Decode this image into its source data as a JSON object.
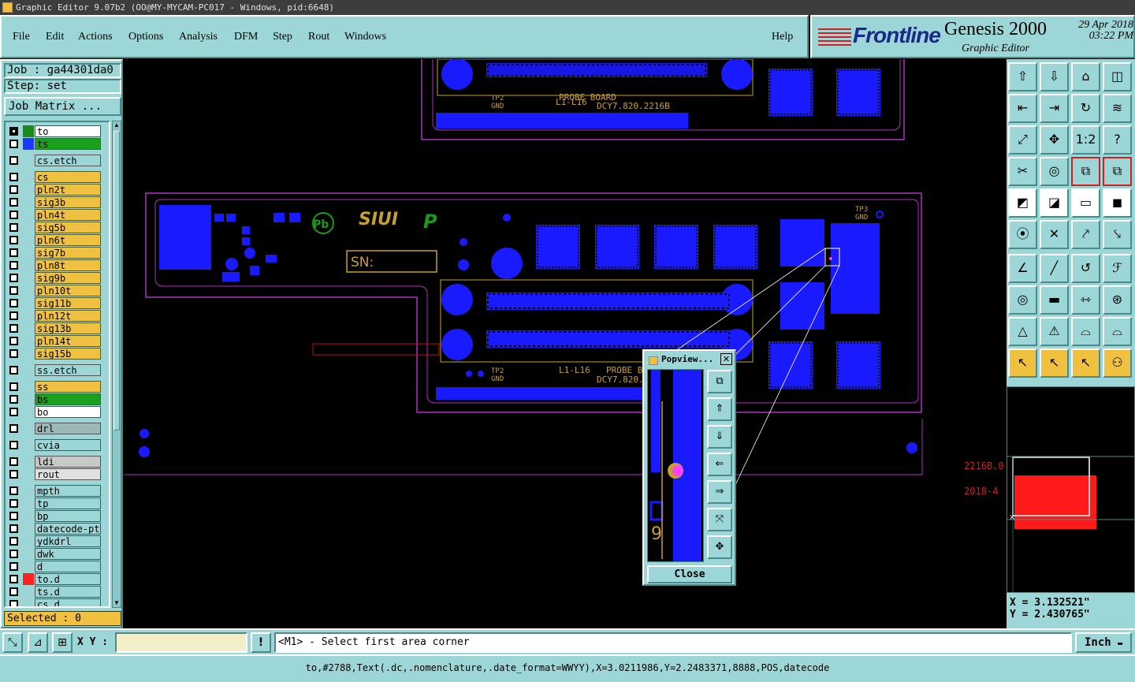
{
  "window": {
    "title": "Graphic Editor 9.07b2 (OO@MY-MYCAM-PC017 - Windows, pid:6648)"
  },
  "menu": {
    "file": "File",
    "edit": "Edit",
    "actions": "Actions",
    "options": "Options",
    "analysis": "Analysis",
    "dfm": "DFM",
    "step": "Step",
    "rout": "Rout",
    "windows": "Windows",
    "help": "Help"
  },
  "brand": {
    "logo": "Frontline",
    "product": "Genesis 2000",
    "subtitle": "Graphic Editor",
    "date": "29 Apr 2018",
    "time": "03:22 PM"
  },
  "job": {
    "job_label": "Job : ga44301da0",
    "step_label": "Step: set",
    "job_matrix": "Job Matrix ..."
  },
  "layers": [
    {
      "name": "to",
      "swatch": "#1a8a1a",
      "bg": "#ffffff",
      "checked": true
    },
    {
      "name": "ts",
      "swatch": "#1a3aff",
      "bg": "#1aa01a",
      "checked": false
    },
    {
      "name": "cs.etch",
      "swatch": "",
      "bg": "#9cd6d6",
      "checked": false
    },
    {
      "name": "cs",
      "swatch": "",
      "bg": "#f0c040",
      "checked": false
    },
    {
      "name": "pln2t",
      "swatch": "",
      "bg": "#f0c040",
      "checked": false
    },
    {
      "name": "sig3b",
      "swatch": "",
      "bg": "#f0c040",
      "checked": false
    },
    {
      "name": "pln4t",
      "swatch": "",
      "bg": "#f0c040",
      "checked": false
    },
    {
      "name": "sig5b",
      "swatch": "",
      "bg": "#f0c040",
      "checked": false
    },
    {
      "name": "pln6t",
      "swatch": "",
      "bg": "#f0c040",
      "checked": false
    },
    {
      "name": "sig7b",
      "swatch": "",
      "bg": "#f0c040",
      "checked": false
    },
    {
      "name": "pln8t",
      "swatch": "",
      "bg": "#f0c040",
      "checked": false
    },
    {
      "name": "sig9b",
      "swatch": "",
      "bg": "#f0c040",
      "checked": false
    },
    {
      "name": "pln10t",
      "swatch": "",
      "bg": "#f0c040",
      "checked": false
    },
    {
      "name": "sig11b",
      "swatch": "",
      "bg": "#f0c040",
      "checked": false
    },
    {
      "name": "pln12t",
      "swatch": "",
      "bg": "#f0c040",
      "checked": false
    },
    {
      "name": "sig13b",
      "swatch": "",
      "bg": "#f0c040",
      "checked": false
    },
    {
      "name": "pln14t",
      "swatch": "",
      "bg": "#f0c040",
      "checked": false
    },
    {
      "name": "sig15b",
      "swatch": "",
      "bg": "#f0c040",
      "checked": false
    },
    {
      "name": "ss.etch",
      "swatch": "",
      "bg": "#9cd6d6",
      "checked": false
    },
    {
      "name": "ss",
      "swatch": "",
      "bg": "#f0c040",
      "checked": false
    },
    {
      "name": "bs",
      "swatch": "",
      "bg": "#1aa01a",
      "checked": false
    },
    {
      "name": "bo",
      "swatch": "",
      "bg": "#ffffff",
      "checked": false
    },
    {
      "name": "drl",
      "swatch": "",
      "bg": "#9cb8b8",
      "checked": false
    },
    {
      "name": "cvia",
      "swatch": "",
      "bg": "#9cd6d6",
      "checked": false
    },
    {
      "name": "ldi",
      "swatch": "",
      "bg": "#c8c8c8",
      "checked": false
    },
    {
      "name": "rout",
      "swatch": "",
      "bg": "#e0e0e0",
      "checked": false
    },
    {
      "name": "mpth",
      "swatch": "",
      "bg": "#9cd6d6",
      "checked": false
    },
    {
      "name": "tp",
      "swatch": "",
      "bg": "#9cd6d6",
      "checked": false
    },
    {
      "name": "bp",
      "swatch": "",
      "bg": "#9cd6d6",
      "checked": false
    },
    {
      "name": "datecode-ptc",
      "swatch": "",
      "bg": "#9cd6d6",
      "checked": false
    },
    {
      "name": "ydkdrl",
      "swatch": "",
      "bg": "#9cd6d6",
      "checked": false
    },
    {
      "name": "dwk",
      "swatch": "",
      "bg": "#9cd6d6",
      "checked": false
    },
    {
      "name": "d",
      "swatch": "",
      "bg": "#9cd6d6",
      "checked": false
    },
    {
      "name": "to.d",
      "swatch": "#ff2020",
      "bg": "#9cd6d6",
      "checked": false
    },
    {
      "name": "ts.d",
      "swatch": "",
      "bg": "#9cd6d6",
      "checked": false
    },
    {
      "name": "cs.d",
      "swatch": "",
      "bg": "#9cd6d6",
      "checked": false
    }
  ],
  "selected": "Selected : 0",
  "pcb": {
    "probe_board": "PROBE BOARD",
    "part_no": "DCY7.820.2216B",
    "layers_range": "L1-L16",
    "tp2": "TP2",
    "gnd": "GND",
    "siui": "SIUI",
    "sn": "SN:",
    "tp3": "TP3",
    "red_text_1": "2216B.0",
    "red_text_2": "2018-4"
  },
  "popview": {
    "title": "Popview...",
    "close": "Close"
  },
  "coords": {
    "x": "X = 3.132521\"",
    "y": "Y = 2.430765\""
  },
  "command": {
    "xy_label": "X Y :",
    "xy_value": "",
    "prompt": "<M1> - Select first area corner",
    "unit": "Inch"
  },
  "status": "to,#2788,Text(.dc,.nomenclature,.date_format=WWYY),X=3.0211986,Y=2.2483371,8888,POS,datecode",
  "icons": {
    "toolbar": [
      "home-up-icon",
      "zoom-down-icon",
      "home-icon",
      "split-view-icon",
      "pan-left-icon",
      "pan-right-icon",
      "refresh-icon",
      "snap-icon",
      "fit-icon",
      "center-icon",
      "one-to-one-icon",
      "help-icon",
      "measure-icon",
      "target-icon",
      "layer-icon",
      "layer-stack-icon",
      "pointer-box-icon",
      "draw-icon",
      "ruler-icon",
      "dot-box-icon",
      "move-icon",
      "cross-icon",
      "connect-icon",
      "connect2-icon",
      "angle-icon",
      "line-icon",
      "rotate-icon",
      "text-icon",
      "mark-icon",
      "minus-icon",
      "scale-icon",
      "group-icon",
      "warn-icon",
      "warn2-icon",
      "arc-icon",
      "arc2-icon",
      "arrow-icon",
      "arrow-box-icon",
      "arrow-select-icon",
      "net-icon"
    ]
  }
}
